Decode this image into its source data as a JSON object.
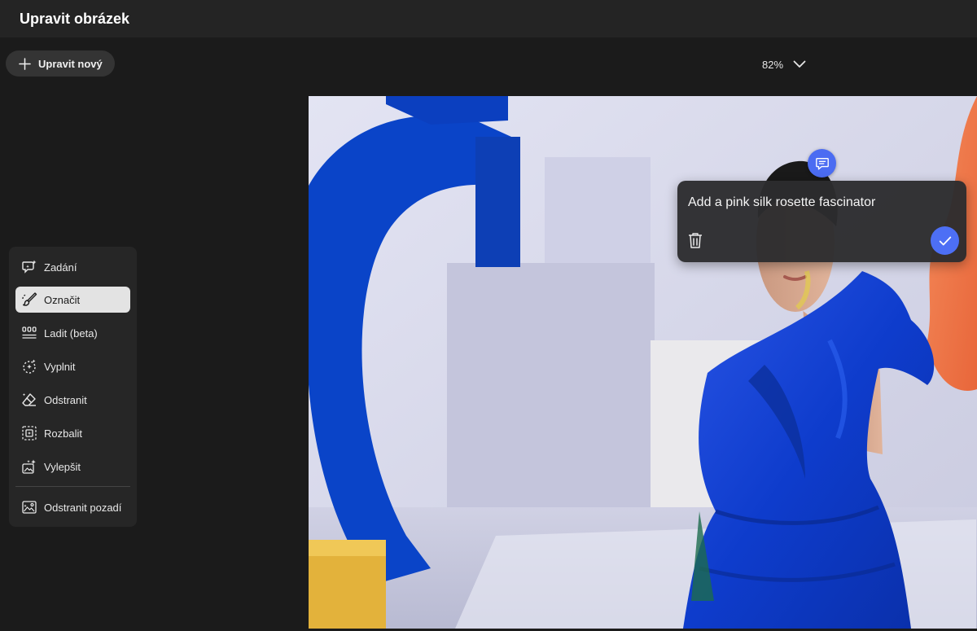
{
  "app": {
    "title": "Upravit obrázek"
  },
  "toolbar": {
    "new_edit_label": "Upravit nový",
    "new_edit_icon": "plus-icon",
    "zoom_value": "82%",
    "zoom_icon": "chevron-down-icon"
  },
  "tools": [
    {
      "label": "Zadání",
      "icon": "prompt-sparkle-icon",
      "active": false
    },
    {
      "label": "Označit",
      "icon": "brush-select-icon",
      "active": true
    },
    {
      "label": "Ladit (beta)",
      "icon": "adjust-sliders-icon",
      "active": false
    },
    {
      "label": "Vyplnit",
      "icon": "fill-icon",
      "active": false
    },
    {
      "label": "Odstranit",
      "icon": "eraser-icon",
      "active": false
    },
    {
      "label": "Rozbalit",
      "icon": "expand-icon",
      "active": false
    },
    {
      "label": "Vylepšit",
      "icon": "enhance-icon",
      "active": false
    },
    {
      "label": "Odstranit pozadí",
      "icon": "remove-background-icon",
      "active": false
    }
  ],
  "prompt_card": {
    "text": "Add a pink silk rosette fascinator",
    "delete_icon": "trash-icon",
    "confirm_icon": "checkmark-icon",
    "bubble_icon": "comment-icon"
  },
  "colors": {
    "accent": "#4d6ff5",
    "background": "#1b1b1b",
    "panel": "#262626",
    "active_tool": "#e3e3e3"
  }
}
